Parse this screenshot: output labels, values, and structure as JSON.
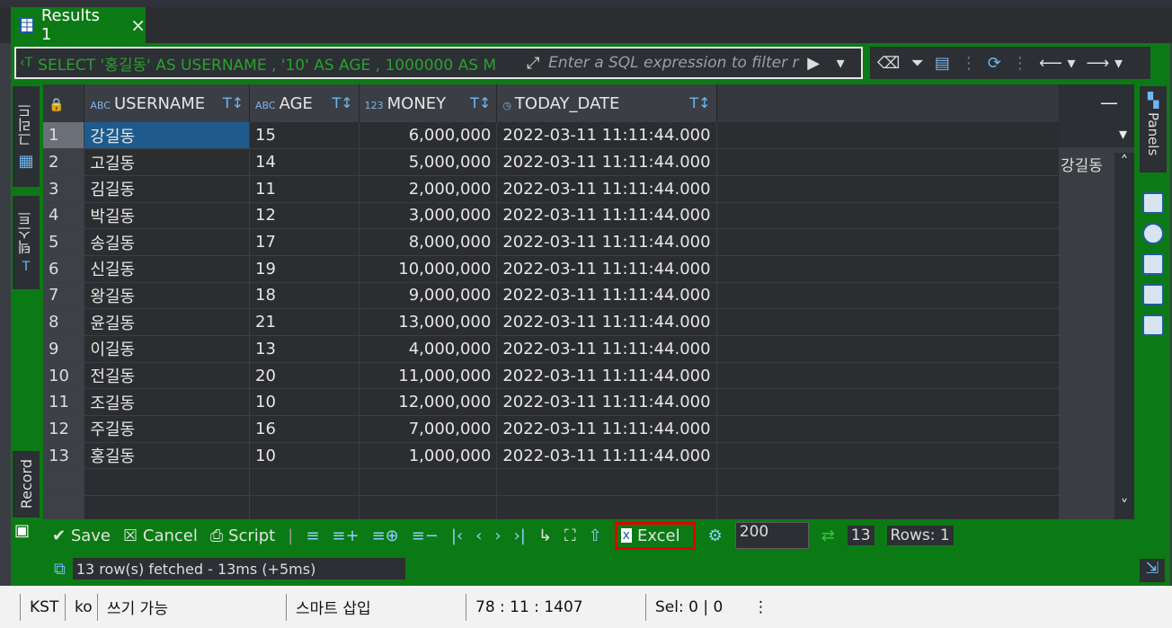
{
  "tab": {
    "title": "Results 1",
    "close_icon": "×"
  },
  "filterbar": {
    "sql_preview": "SELECT '홍길동' AS USERNAME , '10' AS AGE , 1000000 AS M",
    "filter_placeholder": "Enter a SQL expression to filter r"
  },
  "left_tabs": {
    "grid": "그리드",
    "text": "텍스트",
    "record": "Record"
  },
  "columns": [
    {
      "type": "ABC",
      "name": "USERNAME"
    },
    {
      "type": "ABC",
      "name": "AGE"
    },
    {
      "type": "123",
      "name": "MONEY"
    },
    {
      "type": "clock",
      "name": "TODAY_DATE"
    }
  ],
  "rows": [
    {
      "n": "1",
      "username": "강길동",
      "age": "15",
      "money": "6,000,000",
      "date": "2022-03-11 11:11:44.000"
    },
    {
      "n": "2",
      "username": "고길동",
      "age": "14",
      "money": "5,000,000",
      "date": "2022-03-11 11:11:44.000"
    },
    {
      "n": "3",
      "username": "김길동",
      "age": "11",
      "money": "2,000,000",
      "date": "2022-03-11 11:11:44.000"
    },
    {
      "n": "4",
      "username": "박길동",
      "age": "12",
      "money": "3,000,000",
      "date": "2022-03-11 11:11:44.000"
    },
    {
      "n": "5",
      "username": "송길동",
      "age": "17",
      "money": "8,000,000",
      "date": "2022-03-11 11:11:44.000"
    },
    {
      "n": "6",
      "username": "신길동",
      "age": "19",
      "money": "10,000,000",
      "date": "2022-03-11 11:11:44.000"
    },
    {
      "n": "7",
      "username": "왕길동",
      "age": "18",
      "money": "9,000,000",
      "date": "2022-03-11 11:11:44.000"
    },
    {
      "n": "8",
      "username": "윤길동",
      "age": "21",
      "money": "13,000,000",
      "date": "2022-03-11 11:11:44.000"
    },
    {
      "n": "9",
      "username": "이길동",
      "age": "13",
      "money": "4,000,000",
      "date": "2022-03-11 11:11:44.000"
    },
    {
      "n": "10",
      "username": "전길동",
      "age": "20",
      "money": "11,000,000",
      "date": "2022-03-11 11:11:44.000"
    },
    {
      "n": "11",
      "username": "조길동",
      "age": "10",
      "money": "12,000,000",
      "date": "2022-03-11 11:11:44.000"
    },
    {
      "n": "12",
      "username": "주길동",
      "age": "16",
      "money": "7,000,000",
      "date": "2022-03-11 11:11:44.000"
    },
    {
      "n": "13",
      "username": "홍길동",
      "age": "10",
      "money": "1,000,000",
      "date": "2022-03-11 11:11:44.000"
    }
  ],
  "value_panel": {
    "value": "강길동"
  },
  "panels_label": "Panels",
  "bottom_toolbar": {
    "save": "Save",
    "cancel": "Cancel",
    "script": "Script",
    "excel": "Excel",
    "fetch_size": "200",
    "row_count": "13",
    "rows_label": "Rows: 1"
  },
  "status_message": "13 row(s) fetched - 13ms (+5ms)",
  "statusline": {
    "timezone": "KST",
    "locale": "ko",
    "mode": "쓰기 가능",
    "insert": "스마트 삽입",
    "position": "78 : 11 : 1407",
    "selection": "Sel: 0 | 0"
  },
  "colors": {
    "accent_green": "#0c7a14",
    "highlight_red": "#e00000",
    "selection_blue": "#1e5a8c"
  }
}
